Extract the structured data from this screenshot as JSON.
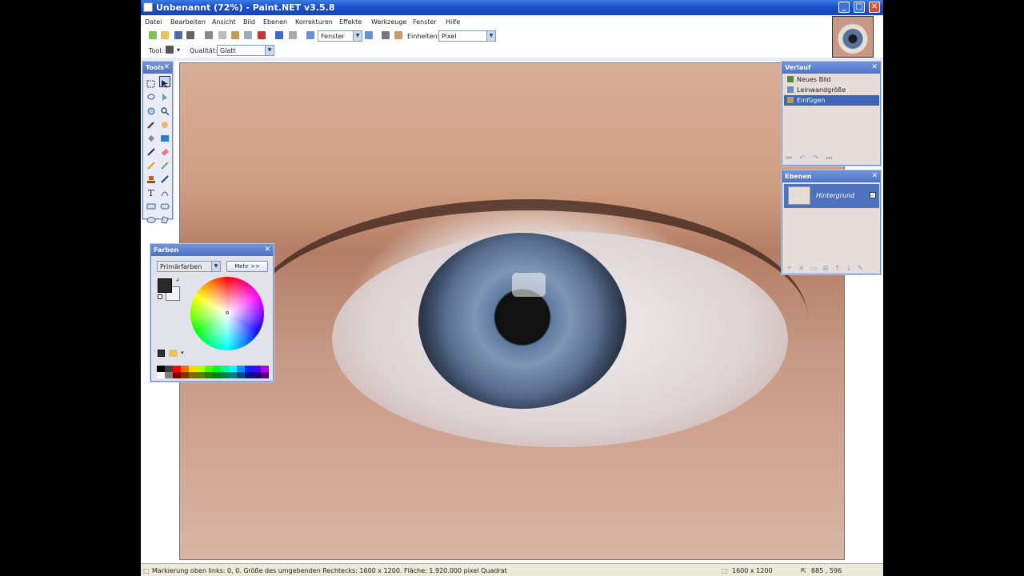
{
  "window": {
    "title": "Unbenannt (72%) - Paint.NET v3.5.8",
    "buttons": [
      "_",
      "□",
      "✕"
    ]
  },
  "menu": [
    "Datei",
    "Bearbeiten",
    "Ansicht",
    "Bild",
    "Ebenen",
    "Korrekturen",
    "Effekte",
    "Werkzeuge",
    "Fenster",
    "Hilfe"
  ],
  "toolbar": {
    "zoom_value": "Fenster",
    "units_label": "Einheiten:",
    "units_value": "Pixel"
  },
  "toolbar2": {
    "tool_label": "Tool:",
    "quality_label": "Qualität:",
    "quality_value": "Glatt"
  },
  "tools_panel": {
    "title": "Tools"
  },
  "farben_panel": {
    "title": "Farben",
    "mode_value": "Primärfarben",
    "more_button": "Mehr >>",
    "primary_color": "#2a2a2a",
    "secondary_color": "#f3f3f3"
  },
  "verlauf_panel": {
    "title": "Verlauf",
    "items": [
      {
        "label": "Neues Bild"
      },
      {
        "label": "Leinwandgröße"
      },
      {
        "label": "Einfügen"
      }
    ]
  },
  "ebenen_panel": {
    "title": "Ebenen",
    "layer_name": "Hintergrund"
  },
  "status": {
    "message": "Markierung oben links: 0, 0. Größe des umgebenden Rechtecks: 1600 x 1200. Fläche: 1.920.000 pixel Quadrat",
    "image_size": "1600 x 1200",
    "cursor_pos": "885 , 596"
  }
}
